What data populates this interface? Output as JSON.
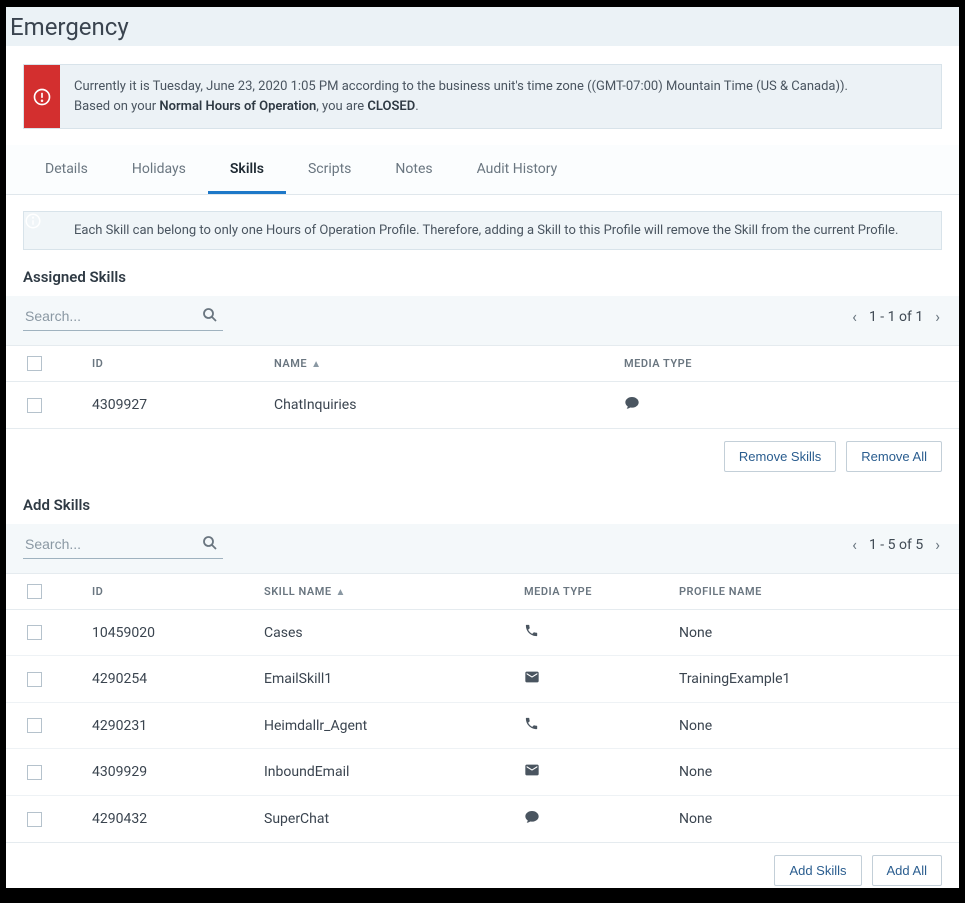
{
  "title": "Emergency",
  "alert": {
    "line1_a": "Currently it is Tuesday, June 23, 2020 1:05 PM according to the business unit's time zone ((GMT-07:00) Mountain Time (US & Canada)).",
    "line2_a": "Based on your ",
    "line2_b": "Normal Hours of Operation",
    "line2_c": ", you are ",
    "line2_d": "CLOSED",
    "line2_e": "."
  },
  "tabs": [
    {
      "label": "Details",
      "active": false
    },
    {
      "label": "Holidays",
      "active": false
    },
    {
      "label": "Skills",
      "active": true
    },
    {
      "label": "Scripts",
      "active": false
    },
    {
      "label": "Notes",
      "active": false
    },
    {
      "label": "Audit History",
      "active": false
    }
  ],
  "info_msg": "Each Skill can belong to only one Hours of Operation Profile. Therefore, adding a Skill to this Profile will remove the Skill from the current Profile.",
  "assigned": {
    "title": "Assigned Skills",
    "search_ph": "Search...",
    "pager": "1 - 1 of 1",
    "columns": {
      "id": "ID",
      "name": "NAME",
      "media": "MEDIA TYPE"
    },
    "rows": [
      {
        "id": "4309927",
        "name": "ChatInquiries",
        "media": "chat"
      }
    ],
    "remove_btn": "Remove Skills",
    "remove_all_btn": "Remove All"
  },
  "add": {
    "title": "Add Skills",
    "search_ph": "Search...",
    "pager": "1 - 5 of 5",
    "columns": {
      "id": "ID",
      "name": "SKILL NAME",
      "media": "MEDIA TYPE",
      "profile": "PROFILE NAME"
    },
    "rows": [
      {
        "id": "10459020",
        "name": "Cases",
        "media": "phone",
        "profile": "None"
      },
      {
        "id": "4290254",
        "name": "EmailSkill1",
        "media": "email",
        "profile": "TrainingExample1"
      },
      {
        "id": "4290231",
        "name": "Heimdallr_Agent",
        "media": "phone",
        "profile": "None"
      },
      {
        "id": "4309929",
        "name": "InboundEmail",
        "media": "email",
        "profile": "None"
      },
      {
        "id": "4290432",
        "name": "SuperChat",
        "media": "chat",
        "profile": "None"
      }
    ],
    "add_btn": "Add Skills",
    "add_all_btn": "Add All"
  }
}
